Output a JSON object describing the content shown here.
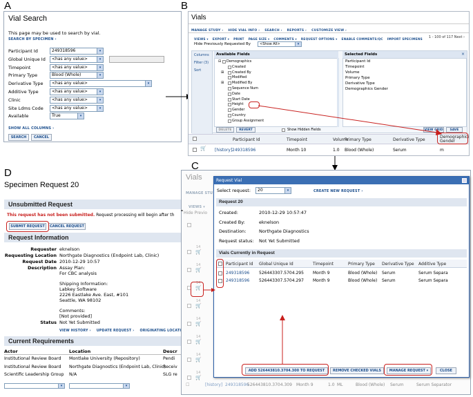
{
  "letters": {
    "a": "A",
    "b": "B",
    "c": "C",
    "d": "D"
  },
  "panelA": {
    "title": "Vial Search",
    "description": "This page may be used to search by vial.",
    "search_link": "SEARCH BY SPECIMEN ›",
    "fields": [
      {
        "label": "Participant Id",
        "value": "249318596"
      },
      {
        "label": "Global Unique Id",
        "value": "<has any value>"
      },
      {
        "label": "Timepoint",
        "value": "<has any value>"
      },
      {
        "label": "Primary Type",
        "value": "Blood (Whole)"
      },
      {
        "label": "Derivative Type",
        "value": "<has any value>"
      },
      {
        "label": "Additive Type",
        "value": "<has any value>"
      },
      {
        "label": "Clinic",
        "value": "<has any value>"
      },
      {
        "label": "Site Ldms Code",
        "value": "<has any value>"
      },
      {
        "label": "Available",
        "value": "True"
      }
    ],
    "show_all": "SHOW ALL COLUMNS ›",
    "search_btn": "SEARCH",
    "cancel_btn": "CANCEL"
  },
  "panelB": {
    "title": "Vials",
    "menu": [
      "MANAGE STUDY ›",
      "HIDE VIAL INFO ›",
      "SEARCH ›",
      "REPORTS ›",
      "CUSTOMIZE VIEW ›"
    ],
    "toolbar": [
      "VIEWS ▾",
      "EXPORT ▾",
      "PRINT",
      "PAGE SIZE ▾",
      "COMMENTS ▾",
      "REQUEST OPTIONS ▾",
      "ENABLE COMMENTS/QC",
      "IMPORT SPECIMENS"
    ],
    "paging": "1 - 100 of 117 Next ›",
    "hide_prev": "Hide Previously Requested By",
    "show_all": "<Show All>",
    "tabs": [
      "Columns",
      "Filter (3)",
      "Sort"
    ],
    "available_title": "Available Fields",
    "available": [
      "Demographics",
      "Created",
      "Created By",
      "Modified",
      "Modified By",
      "Sequence Num",
      "Date",
      "Start Date",
      "Height",
      "Gender",
      "Country",
      "Group Assignment"
    ],
    "show_hidden": "Show Hidden Fields",
    "selected_title": "Selected Fields",
    "selected": [
      "Participant Id",
      "Timepoint",
      "Volume",
      "Primary Type",
      "Derivative Type",
      "Demographics Gender"
    ],
    "delete_btn": "DELETE",
    "revert_btn": "REVERT",
    "viewgrid_btn": "VIEW GRID",
    "save_btn": "SAVE",
    "cols": [
      "Participant Id",
      "Timepoint",
      "Volume",
      "Primary Type",
      "Derivative Type",
      "Demographics Gender"
    ],
    "row": {
      "history": "[history]",
      "pid": "249318596",
      "tp": "Month 10",
      "vol": "1.0",
      "ptype": "Blood (Whole)",
      "dtype": "Serum",
      "gender": "m"
    }
  },
  "panelC": {
    "bg_title": "Vials",
    "bg_manage": "MANAGE STU",
    "bg_views": "VIEWS ▾",
    "bg_hide": "Hide Previo",
    "dialog_title": "Request Vial",
    "select_label": "Select request:",
    "select_value": "20",
    "create_link": "CREATE NEW REQUEST ›",
    "req_header": "Request 20",
    "info": [
      {
        "k": "Created:",
        "v": "2010-12-29 10:57:47"
      },
      {
        "k": "Created By:",
        "v": "eknelson"
      },
      {
        "k": "Destination:",
        "v": "Northgate Diagnostics"
      },
      {
        "k": "Request status:",
        "v": "Not Yet Submitted"
      }
    ],
    "vials_header": "Vials Currently in Request",
    "cols": [
      "Participant Id",
      "Global Unique Id",
      "Timepoint",
      "Primary Type",
      "Derivative Type",
      "Additive Type"
    ],
    "rows": [
      [
        "249318596",
        "526443307.5704.295",
        "Month 9",
        "Blood (Whole)",
        "Serum",
        "Serum Separa"
      ],
      [
        "249318596",
        "526443307.5704.297",
        "Month 9",
        "Blood (Whole)",
        "Serum",
        "Serum Separa"
      ]
    ],
    "add_btn": "ADD 526443810.3704.300 TO REQUEST",
    "remove_btn": "REMOVE CHECKED VIALS",
    "manage_btn": "MANAGE REQUEST ▾",
    "close_btn": "CLOSE",
    "bottom_row": [
      "[history]",
      "249318596",
      "526443810.3704.309",
      "Month 9",
      "1.0",
      "ML",
      "Blood (Whole)",
      "Serum",
      "Serum Separator"
    ],
    "side_nums": [
      "14",
      "14",
      "14",
      "14",
      "14",
      "14",
      "14",
      "14"
    ]
  },
  "panelD": {
    "title": "Specimen Request 20",
    "unsubmitted": "Unsubmitted Request",
    "warn_bold": "This request has not been submitted.",
    "warn_rest": " Request processing will begin after th",
    "submit_btn": "SUBMIT REQUEST",
    "cancel_btn": "CANCEL REQUEST",
    "info_header": "Request Information",
    "requester_k": "Requester",
    "requester_v": "eknelson",
    "location_k": "Requesting Location",
    "location_v": "Northgate Diagnostics (Endpoint Lab, Clinic)",
    "date_k": "Request Date",
    "date_v": "2010-12-29 10:57",
    "desc_k": "Description",
    "desc_v1": "Assay Plan:",
    "desc_v2": "For CBC analysis",
    "ship1": "Shipping Information:",
    "ship2": "Labkey Software",
    "ship3": "2226 Eastlake Ave. East, #101",
    "ship4": "Seattle, WA 98102",
    "comments1": "Comments:",
    "comments2": "[Not provided]",
    "status_k": "Status",
    "status_v": "Not Yet Submitted",
    "links": [
      "VIEW HISTORY ›",
      "UPDATE REQUEST ›",
      "ORIGINATING LOCATION"
    ],
    "req_header": "Current Requirements",
    "req_cols": [
      "Actor",
      "Location",
      "Descr"
    ],
    "req_rows": [
      [
        "Institutional Review Board",
        "Montlake University (Repository)",
        "Pendi"
      ],
      [
        "Institutional Review Board",
        "Northgate Diagnostics (Endpoint Lab, Clinic)",
        "Receiv"
      ],
      [
        "Scientific Leadership Group",
        "N/A",
        "SLG re"
      ]
    ]
  }
}
